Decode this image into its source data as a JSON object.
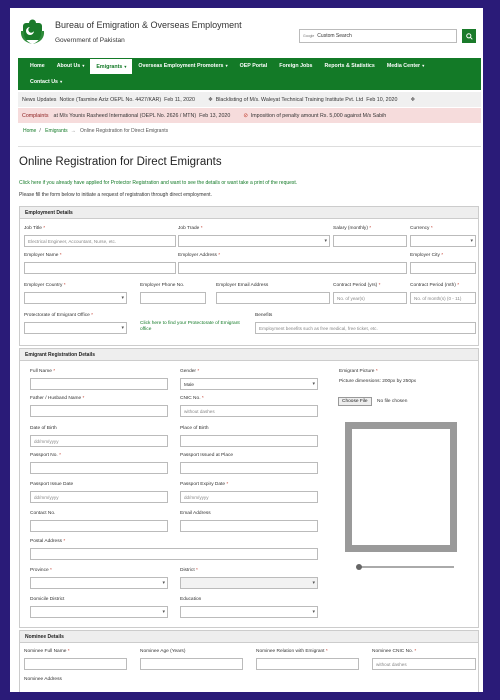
{
  "header": {
    "title": "Bureau of Emigration & Overseas Employment",
    "subtitle": "Government of Pakistan",
    "search_label": "Google",
    "search_placeholder": "Custom Search",
    "search_button_icon": "search-icon"
  },
  "nav": {
    "row1": [
      {
        "label": "Home",
        "dropdown": false,
        "active": false
      },
      {
        "label": "About Us",
        "dropdown": true,
        "active": false
      },
      {
        "label": "Emigrants",
        "dropdown": true,
        "active": true
      },
      {
        "label": "Overseas Employment Promoters",
        "dropdown": true,
        "active": false
      },
      {
        "label": "OEP Portal",
        "dropdown": false,
        "active": false
      },
      {
        "label": "Foreign Jobs",
        "dropdown": false,
        "active": false
      },
      {
        "label": "Reports & Statistics",
        "dropdown": false,
        "active": false
      },
      {
        "label": "Media Center",
        "dropdown": true,
        "active": false
      }
    ],
    "row2": [
      {
        "label": "Contact Us",
        "dropdown": true,
        "active": false
      }
    ]
  },
  "ticker": {
    "label": "News Updates",
    "items": [
      {
        "text": "Notice (Tasmine Aziz OEPL No. 4427/KAR)",
        "date": "Feb 11, 2020"
      },
      {
        "text": "Blacklisting of M/s. Waleyat Technical Training Institute Pvt. Ltd",
        "date": "Feb 10, 2020"
      }
    ]
  },
  "complaints": {
    "label": "Complaints",
    "items": [
      {
        "text": "at M/s Younis Rasheed International (OEPL No. 2626 / MTN)",
        "date": "Feb 13, 2020"
      },
      {
        "text": "Imposition of penalty amount Rs. 5,000 against M/s Sabih",
        "date": ""
      }
    ]
  },
  "breadcrumb": [
    "Home",
    "Emigrants",
    "Online Registration for Direct Emigrants"
  ],
  "page": {
    "title": "Online Registration for Direct Emigrants",
    "protector_link": "Click here if you already have applied for Protector Registration and want to see the details or want take a print of the request.",
    "instruction": "Please fill the form below to initiate a request of registration through direct employment."
  },
  "employment": {
    "heading": "Employment Details",
    "job_title_label": "Job Title",
    "job_title_placeholder": "Electrical Engineer, Accountant, Nurse, etc.",
    "job_trade_label": "Job Trade",
    "salary_label": "Salary (monthly)",
    "currency_label": "Currency",
    "employer_name_label": "Employer Name",
    "employer_address_label": "Employer Address",
    "employer_city_label": "Employer City",
    "employer_country_label": "Employer Country",
    "employer_phone_label": "Employer Phone No.",
    "employer_email_label": "Employer Email Address",
    "contract_years_label": "Contract Period (yrs)",
    "contract_years_placeholder": "No. of year(s)",
    "contract_months_label": "Contract Period (mth)",
    "contract_months_placeholder": "No. of month(s) (0 - 11)",
    "protectorate_label": "Protectorate of Emigrant Office",
    "protectorate_link": "Click here to find your Protectorate of Emigrant office",
    "benefits_label": "Benefits",
    "benefits_placeholder": "Employment benefits such as free medical, free ticket, etc."
  },
  "emigrant": {
    "heading": "Emigrant Registration Details",
    "full_name_label": "Full Name",
    "gender_label": "Gender",
    "gender_value": "Male",
    "picture_label": "Emigrant Picture",
    "picture_dims": "Picture dimensions: 200px by 250px",
    "choose_file": "Choose File",
    "no_file": "No file chosen",
    "father_label": "Father / Husband Name",
    "cnic_label": "CNIC No.",
    "cnic_placeholder": "without dashes",
    "dob_label": "Date of Birth",
    "dob_placeholder": "dd/mm/yyyy",
    "pob_label": "Place of Birth",
    "passport_label": "Passport No.",
    "passport_place_label": "Passport Issued at Place",
    "passport_issue_label": "Passport Issue Date",
    "passport_issue_placeholder": "dd/mm/yyyy",
    "passport_expiry_label": "Passport Expiry Date",
    "passport_expiry_placeholder": "dd/mm/yyyy",
    "contact_label": "Contact No.",
    "email_label": "Email Address",
    "postal_label": "Postal Address",
    "province_label": "Province",
    "district_label": "District",
    "domicile_label": "Domicile District",
    "education_label": "Education"
  },
  "nominee": {
    "heading": "Nominee Details",
    "full_name_label": "Nominee Full Name",
    "age_label": "Nominee Age (Years)",
    "relation_label": "Nominee Relation with Emigrant",
    "cnic_label": "Nominee CNIC No.",
    "cnic_placeholder": "without dashes",
    "address_label": "Nominee Address"
  },
  "colors": {
    "background": "#2a1b78",
    "nav_green": "#137a27",
    "complaints_bg": "#f6dcdc",
    "required": "#c0392b"
  }
}
